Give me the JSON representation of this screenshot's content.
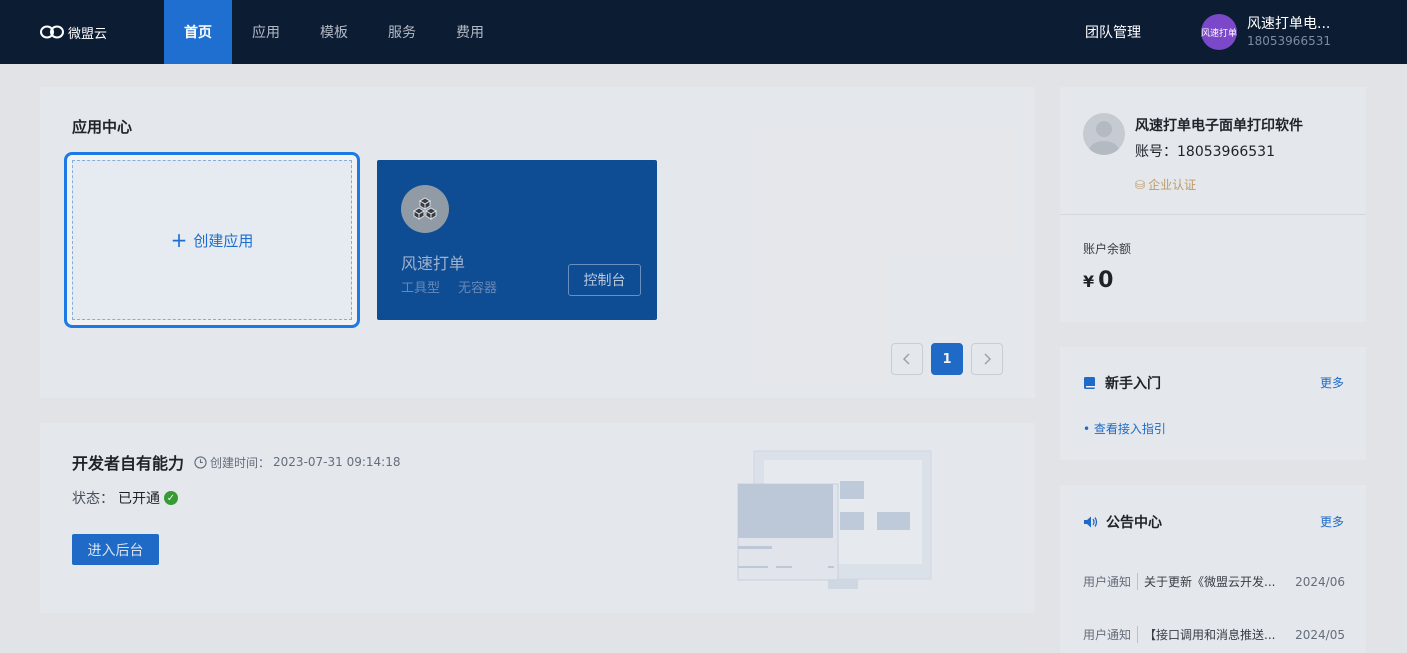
{
  "brand": {
    "logo_text": "微盟云"
  },
  "nav": {
    "items": [
      {
        "label": "首页",
        "active": true
      },
      {
        "label": "应用",
        "active": false
      },
      {
        "label": "模板",
        "active": false
      },
      {
        "label": "服务",
        "active": false
      },
      {
        "label": "费用",
        "active": false
      }
    ],
    "team_label": "团队管理"
  },
  "user": {
    "name": "风速打单电...",
    "phone": "18053966531",
    "avatar_text": "风速打单"
  },
  "app_center": {
    "title": "应用中心",
    "create_label": "创建应用",
    "apps": [
      {
        "name": "风速打单",
        "tags": [
          "工具型",
          "无容器"
        ],
        "button": "控制台"
      }
    ],
    "pagination": {
      "current": "1",
      "prev_icon": "chevron-left-icon",
      "next_icon": "chevron-right-icon"
    }
  },
  "developer": {
    "title": "开发者自有能力",
    "created_prefix": "创建时间：",
    "created_time": "2023-07-31 09:14:18",
    "status_label": "状态：",
    "status_value": "已开通",
    "enter_button": "进入后台"
  },
  "account": {
    "name": "风速打单电子面单打印软件",
    "id_label": "账号：",
    "id_value": "18053966531",
    "cert_label": "企业认证",
    "balance_label": "账户余额",
    "currency": "¥",
    "balance": "0"
  },
  "newbie": {
    "title": "新手入门",
    "more": "更多",
    "items": [
      "查看接入指引"
    ]
  },
  "notice": {
    "title": "公告中心",
    "more": "更多",
    "items": [
      {
        "category": "用户通知",
        "title": "关于更新《微盟云开发...",
        "date": "2024/06"
      },
      {
        "category": "用户通知",
        "title": "【接口调用和消息推送...",
        "date": "2024/05"
      }
    ]
  },
  "colors": {
    "nav_bg": "#0c1c33",
    "accent": "#1f6fd0",
    "app_card_bg": "#0e4f9a",
    "success": "#3aa335"
  }
}
